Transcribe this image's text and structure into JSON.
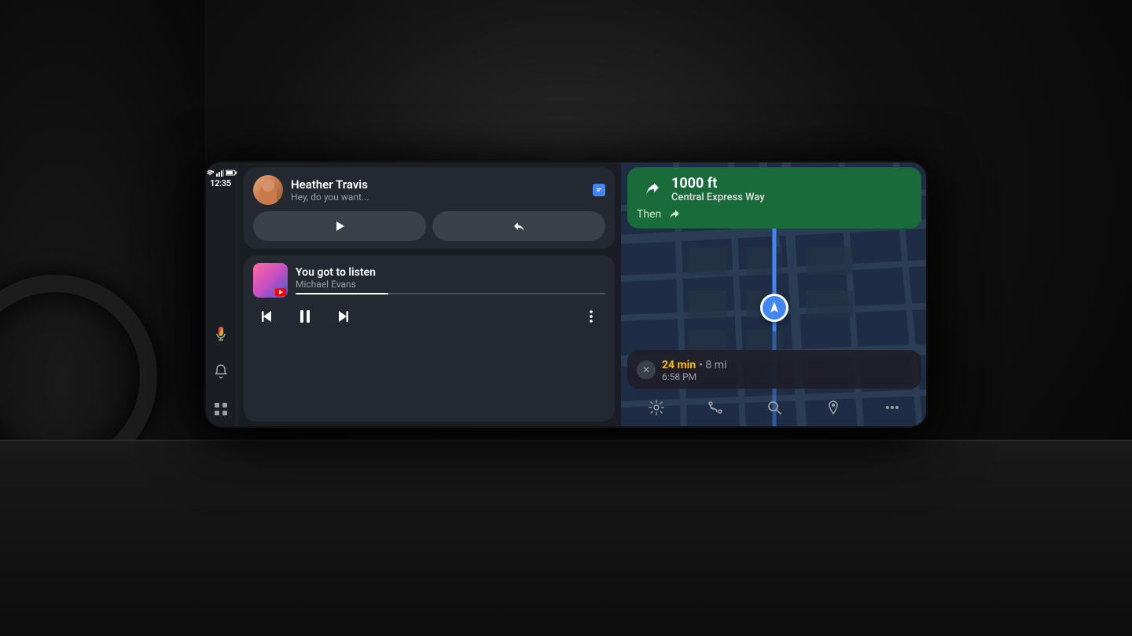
{
  "status": {
    "time": "12:35",
    "wifi": "▲▼",
    "signal": "△",
    "battery": "▮"
  },
  "message": {
    "contact": "Heather Travis",
    "preview": "Hey, do you want...",
    "play_label": "▶",
    "reply_label": "↩"
  },
  "music": {
    "title": "You got to listen",
    "artist": "Michael Evans",
    "progress": 30
  },
  "navigation": {
    "distance": "1000 ft",
    "street": "Central Express Way",
    "then_label": "Then",
    "then_direction": "↩",
    "eta_minutes": "24 min",
    "eta_distance": "8 mi",
    "eta_arrival": "6:58 PM"
  },
  "icons": {
    "microphone": "mic",
    "bell": "🔔",
    "grid": "⠿",
    "prev": "⏮",
    "pause": "⏸",
    "next": "⏭",
    "more": "⋮",
    "settings": "⚙",
    "routes": "⑂",
    "search": "🔍",
    "pin": "📍",
    "overflow": "⋯"
  }
}
